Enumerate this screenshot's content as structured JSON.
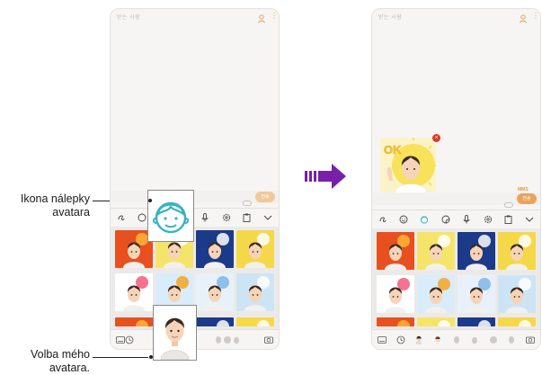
{
  "callouts": {
    "sticker_icon": {
      "line1": "Ikona nálepky",
      "line2": "avatara"
    },
    "my_avatar": {
      "line1": "Volba mého",
      "line2": "avatara."
    }
  },
  "screen": {
    "header_text": "받는 사람",
    "send_label": "전송",
    "mms_label": "MMS",
    "delete_glyph": "×"
  },
  "icons": {
    "contact": "contact-icon",
    "more": "more-vertical-icon",
    "attach": "paperclip-icon",
    "toolbar_left": [
      "handwriting-icon",
      "emoji-icon",
      "avatar-sticker-icon",
      "sticker-icon",
      "microphone-icon",
      "settings-icon",
      "clipboard-icon",
      "chevron-down-icon"
    ],
    "bottom_left": [
      "keyboard-icon",
      "recent-icon",
      "my-avatar-icon",
      "avatar-face-icon",
      "avatar-face-icon",
      "avatar-face-icon",
      "avatar-face-icon",
      "avatar-face-icon",
      "camera-icon"
    ]
  },
  "colors": {
    "accent": "#e39a4a",
    "send_disabled": "#f0c89c",
    "sticker_icon_teal": "#36b3c2",
    "delete_red": "#e0342c",
    "arrow_purple": "#7a1fa8"
  },
  "stickers": [
    {
      "bg": "#e8501f",
      "accent": "#ffb53a"
    },
    {
      "bg": "#f5e46a",
      "accent": "#ffffff"
    },
    {
      "bg": "#1c3a8a",
      "accent": "#ffffff"
    },
    {
      "bg": "#f5d84a",
      "accent": "#ffffff"
    },
    {
      "bg": "#ffffff",
      "accent": "#f25b7c"
    },
    {
      "bg": "#d9ecfa",
      "accent": "#f5a623"
    },
    {
      "bg": "#e8f1fa",
      "accent": "#7fb6e8"
    },
    {
      "bg": "#cde4f5",
      "accent": "#ffffff"
    }
  ]
}
